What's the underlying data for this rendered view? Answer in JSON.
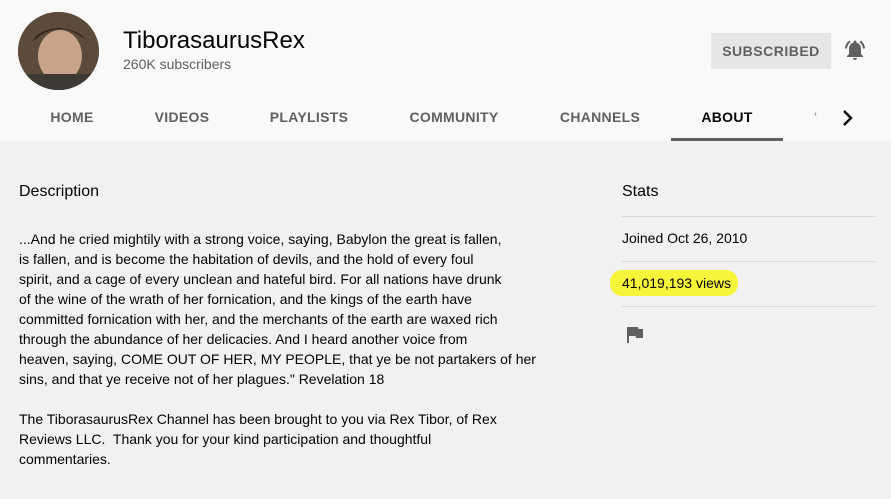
{
  "channel": {
    "name": "TiborasaurusRex",
    "subscribers": "260K subscribers",
    "subscribe_button": "SUBSCRIBED"
  },
  "tabs": [
    {
      "label": "HOME"
    },
    {
      "label": "VIDEOS"
    },
    {
      "label": "PLAYLISTS"
    },
    {
      "label": "COMMUNITY"
    },
    {
      "label": "CHANNELS"
    },
    {
      "label": "ABOUT",
      "active": true
    }
  ],
  "about": {
    "description_title": "Description",
    "description": "...And he cried mightily with a strong voice, saying, Babylon the great is fallen,\nis fallen, and is become the habitation of devils, and the hold of every foul\nspirit, and a cage of every unclean and hateful bird. For all nations have drunk\nof the wine of the wrath of her fornication, and the kings of the earth have\ncommitted fornication with her, and the merchants of the earth are waxed rich\nthrough the abundance of her delicacies. And I heard another voice from\nheaven, saying, COME OUT OF HER, MY PEOPLE, that ye be not partakers of her\nsins, and that ye receive not of her plagues.\" Revelation 18\n\nThe TiborasaurusRex Channel has been brought to you via Rex Tibor, of Rex\nReviews LLC.  Thank you for your kind participation and thoughtful\ncommentaries.",
    "stats_title": "Stats",
    "joined": "Joined Oct 26, 2010",
    "views": "41,019,193 views"
  },
  "colors": {
    "highlight": "#f5f53a",
    "background": "#f1f1f1",
    "header_background": "#f9f9f9"
  },
  "icons": [
    "bell-icon",
    "chevron-right-icon",
    "flag-icon"
  ]
}
